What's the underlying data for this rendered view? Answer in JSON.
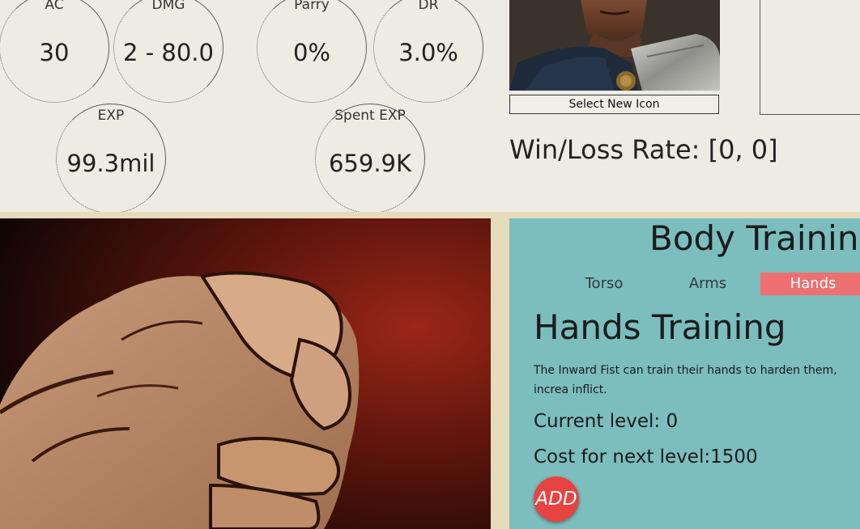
{
  "stats": {
    "ac": {
      "label": "AC",
      "value": "30"
    },
    "dmg": {
      "label": "DMG",
      "value": "2 - 80.0"
    },
    "parry": {
      "label": "Parry",
      "value": "0%"
    },
    "dr": {
      "label": "DR",
      "value": "3.0%"
    },
    "exp": {
      "label": "EXP",
      "value": "99.3mil"
    },
    "spent_exp": {
      "label": "Spent EXP",
      "value": "659.9K"
    }
  },
  "profile": {
    "select_icon_label": "Select New Icon",
    "win_loss": "Win/Loss Rate: [0, 0]"
  },
  "training": {
    "title": "Body Training",
    "tabs": [
      "Torso",
      "Arms",
      "Hands"
    ],
    "active_tab": "Hands",
    "section_title": "Hands Training",
    "description": "The Inward Fist can train their hands to harden them, increa inflict.",
    "current_level": "Current level: 0",
    "cost_next": "Cost for next level:1500",
    "add_label": "ADD"
  },
  "colors": {
    "background": "#eeebe3",
    "panel": "#7cbdbd",
    "active_tab": "#ed7070",
    "add_button": "#e74341",
    "separator": "#e6dcbc"
  }
}
